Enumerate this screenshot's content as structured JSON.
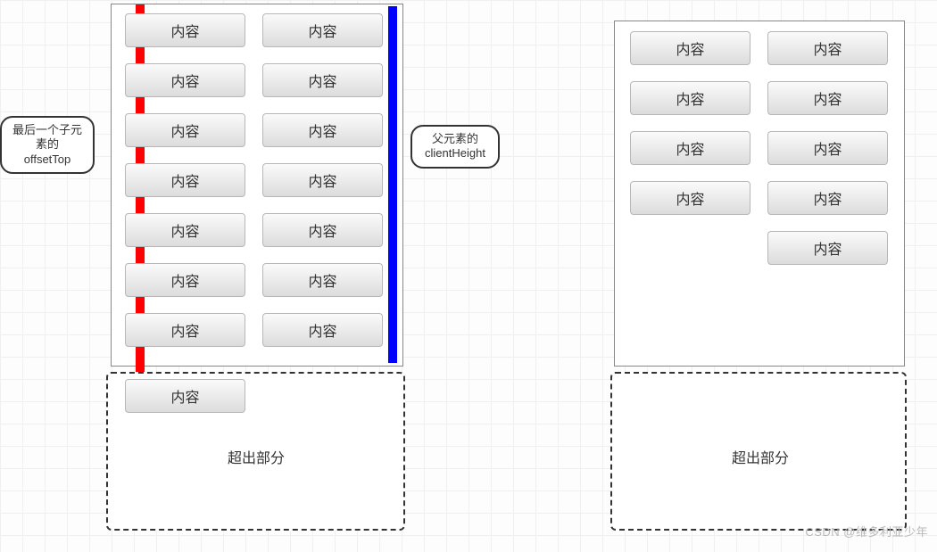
{
  "callouts": {
    "left": "最后一个子元\n素的\noffsetTop",
    "right": "父元素的\nclientHeight"
  },
  "item_label": "内容",
  "overflow_label": "超出部分",
  "left_panel": {
    "rows": 7,
    "extra_below_label": "内容"
  },
  "right_panel": {
    "left_col_rows": 4,
    "right_col_rows": 5
  },
  "colors": {
    "red_bar": "#ff0000",
    "blue_bar": "#0000ff",
    "button_border": "#b7b7b7",
    "box_border": "#888888"
  },
  "watermark": "CSDN @维多利亚少年"
}
